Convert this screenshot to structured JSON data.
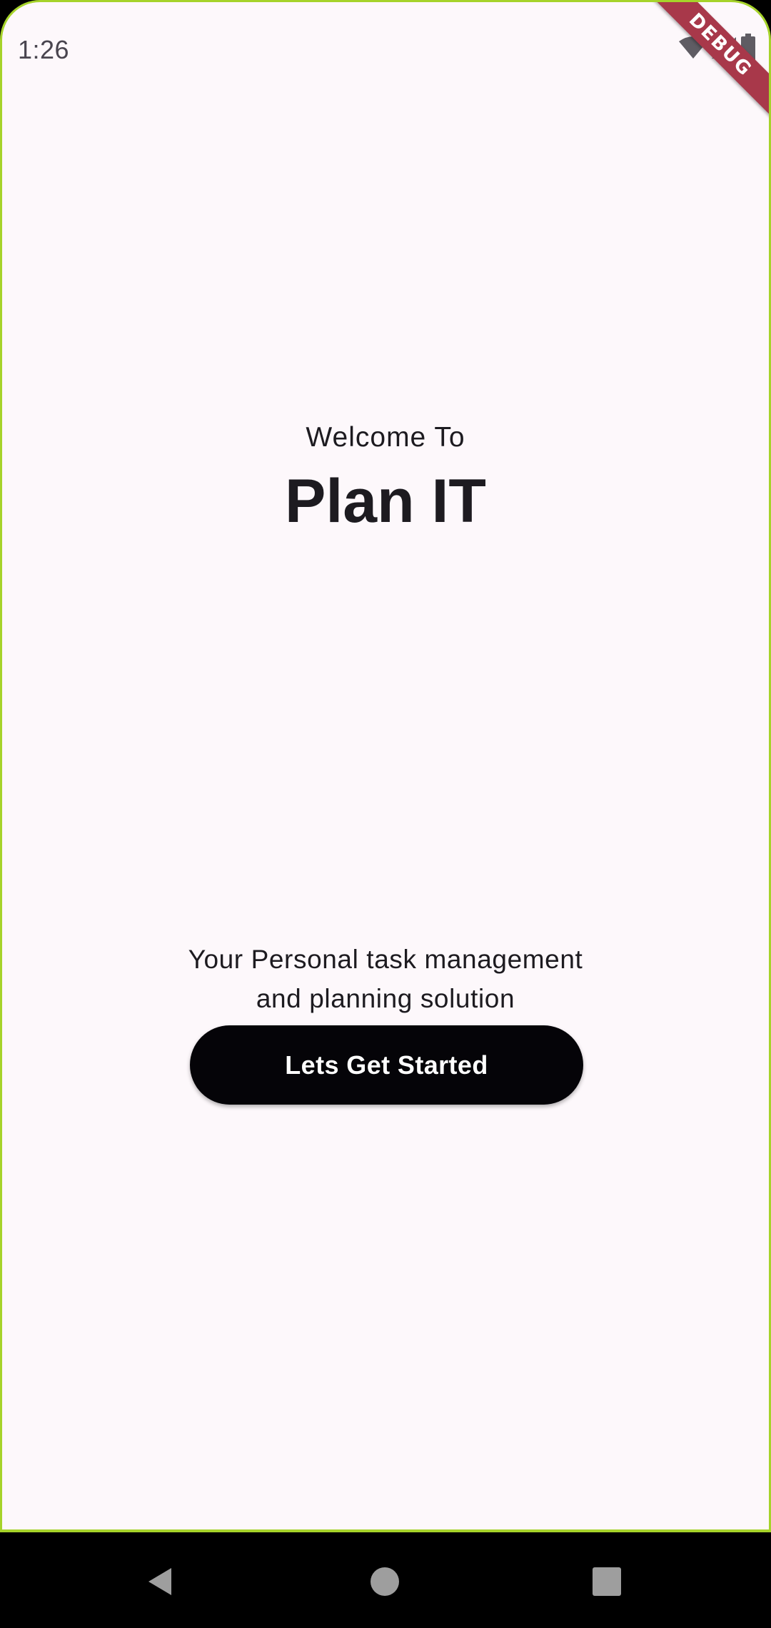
{
  "status_bar": {
    "time": "1:26",
    "icons": [
      "wifi-icon",
      "cellular-signal-icon",
      "battery-icon"
    ]
  },
  "debug_banner": {
    "label": "DEBUG",
    "color": "#a8384a"
  },
  "welcome": {
    "subtitle": "Welcome To",
    "title": "Plan IT"
  },
  "tagline": {
    "line1": "Your Personal task management",
    "line2": "and planning solution"
  },
  "cta": {
    "label": "Lets Get Started",
    "color": "#050408"
  },
  "nav_bar": {
    "buttons": [
      "back-icon",
      "home-icon",
      "recents-icon"
    ]
  },
  "theme": {
    "background": "#fdf8fb",
    "frame_accent": "#a6d32a",
    "text": "#1d1b20"
  }
}
